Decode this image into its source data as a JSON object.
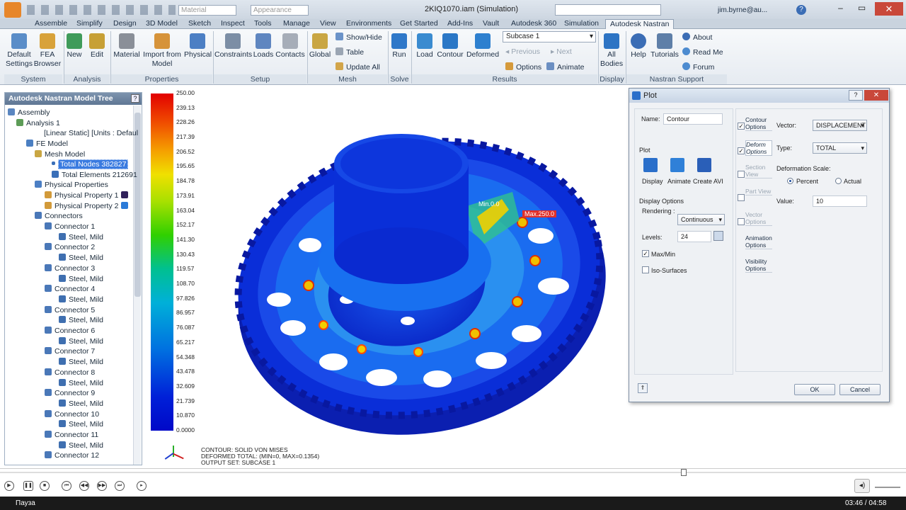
{
  "window": {
    "title": "2KIQ1070.iam (Simulation)",
    "user": "jim.byrne@au...",
    "material_placeholder": "Material",
    "appearance_placeholder": "Appearance"
  },
  "tabs": [
    "Assemble",
    "Simplify",
    "Design",
    "3D Model",
    "Sketch",
    "Inspect",
    "Tools",
    "Manage",
    "View",
    "Environments",
    "Get Started",
    "Add-Ins",
    "Vault",
    "Autodesk 360",
    "Simulation",
    "Autodesk Nastran"
  ],
  "ribbon": {
    "system": {
      "label": "System",
      "default_settings": "Default Settings",
      "fea_browser": "FEA Browser"
    },
    "analysis": {
      "label": "Analysis",
      "new": "New",
      "edit": "Edit"
    },
    "properties": {
      "label": "Properties",
      "material": "Material",
      "import_from_model": "Import from Model",
      "physical": "Physical"
    },
    "setup": {
      "label": "Setup",
      "constraints": "Constraints",
      "loads": "Loads",
      "contacts": "Contacts"
    },
    "mesh": {
      "label": "Mesh",
      "global": "Global",
      "show_hide": "Show/Hide",
      "table": "Table",
      "update_all": "Update  All"
    },
    "solve": {
      "label": "Solve",
      "run": "Run"
    },
    "results": {
      "label": "Results",
      "load": "Load",
      "contour": "Contour",
      "deformed": "Deformed",
      "subcase": "Subcase 1",
      "previous": "Previous",
      "next": "Next",
      "options": "Options",
      "animate": "Animate"
    },
    "display": {
      "label": "Display",
      "all_bodies": "All Bodies"
    },
    "support": {
      "label": "Nastran Support",
      "help": "Help",
      "tutorials": "Tutorials",
      "about": "About",
      "read_me": "Read Me",
      "forum": "Forum"
    }
  },
  "tree": {
    "title": "Autodesk Nastran Model Tree",
    "nodes": [
      "Assembly",
      "Analysis 1",
      "[Linear Static] [Units : Defaul",
      "FE Model",
      "Mesh Model",
      "Total Nodes 382827",
      "Total Elements 212691",
      "Physical Properties",
      "Physical Property 1",
      "Physical Property 2",
      "Connectors"
    ],
    "connectors": [
      "Connector 1",
      "Connector 2",
      "Connector 3",
      "Connector 4",
      "Connector 5",
      "Connector 6",
      "Connector 7",
      "Connector 8",
      "Connector 9",
      "Connector 10",
      "Connector 11",
      "Connector 12"
    ],
    "material": "Steel, Mild"
  },
  "legend": {
    "values": [
      "250.00",
      "239.13",
      "228.26",
      "217.39",
      "206.52",
      "195.65",
      "184.78",
      "173.91",
      "163.04",
      "152.17",
      "141.30",
      "130.43",
      "119.57",
      "108.70",
      "97.826",
      "86.957",
      "76.087",
      "65.217",
      "54.348",
      "43.478",
      "32.609",
      "21.739",
      "10.870",
      "0.0000"
    ]
  },
  "viewport": {
    "min_label": "Min.0.0",
    "max_label": "Max.250.0",
    "info": [
      "CONTOUR: SOLID VON MISES",
      "DEFORMED TOTAL: (MIN=0, MAX=0.1354)",
      "OUTPUT SET: SUBCASE 1"
    ]
  },
  "dialog": {
    "title": "Plot",
    "name_label": "Name:",
    "name_value": "Contour",
    "plot_label": "Plot",
    "display": "Display",
    "animate": "Animate",
    "create_avi": "Create AVI",
    "display_options": "Display Options",
    "rendering_label": "Rendering :",
    "rendering_value": "Continuous",
    "levels_label": "Levels:",
    "levels_value": "24",
    "maxmin": "Max/Min",
    "iso": "Iso-Surfaces",
    "side_tabs": [
      "Contour Options",
      "Deform Options",
      "Section View",
      "Part View",
      "Vector Options",
      "Animation Options",
      "Visibility Options"
    ],
    "vector_label": "Vector:",
    "vector_value": "DISPLACEMENT",
    "type_label": "Type:",
    "type_value": "TOTAL",
    "scale_label": "Deformation Scale:",
    "percent": "Percent",
    "actual": "Actual",
    "value_label": "Value:",
    "value_value": "10",
    "ok": "OK",
    "cancel": "Cancel"
  },
  "player": {
    "status": "Пауза",
    "time": "03:46 / 04:58"
  }
}
